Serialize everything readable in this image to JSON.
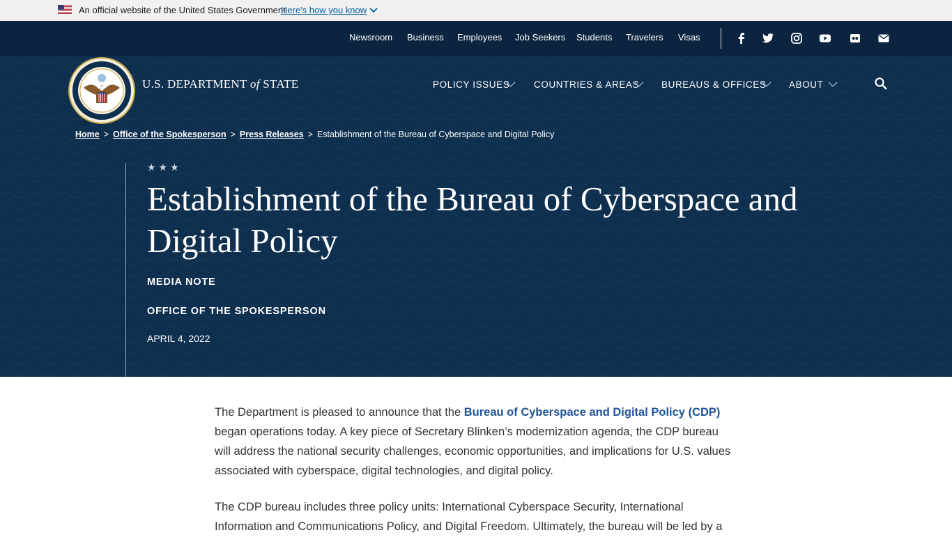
{
  "gov_banner": {
    "text": "An official website of the United States Government",
    "link": "Here's how you know"
  },
  "utility_nav": {
    "items": [
      "Newsroom",
      "Business",
      "Employees",
      "Job Seekers",
      "Students",
      "Travelers",
      "Visas"
    ]
  },
  "social": [
    "facebook-icon",
    "twitter-icon",
    "instagram-icon",
    "youtube-icon",
    "flickr-icon",
    "email-icon"
  ],
  "site": {
    "title_pre": "U.S. DEPARTMENT ",
    "title_of": "of",
    "title_post": " STATE"
  },
  "main_nav": {
    "items": [
      "POLICY ISSUES",
      "COUNTRIES & AREAS",
      "BUREAUS & OFFICES",
      "ABOUT"
    ]
  },
  "breadcrumb": {
    "home": "Home",
    "office": "Office of the Spokesperson",
    "press": "Press Releases",
    "current": "Establishment of the Bureau of Cyberspace and Digital Policy",
    "separator": ">"
  },
  "hero": {
    "stars": "★★★",
    "title": "Establishment of the Bureau of Cyberspace and Digital Policy",
    "type": "MEDIA NOTE",
    "office": "OFFICE OF THE SPOKESPERSON",
    "date": "APRIL 4, 2022"
  },
  "article": {
    "p1_pre": "The Department is pleased to announce that the ",
    "p1_link": "Bureau of Cyberspace and Digital Policy (CDP)",
    "p1_post": " began operations today. A key piece of Secretary Blinken’s modernization agenda, the CDP bureau will address the national security challenges, economic opportunities, and implications for U.S. values associated with cyberspace, digital technologies, and digital policy.",
    "p2": "The CDP bureau includes three policy units: International Cyberspace Security, International Information and Communications Policy, and Digital Freedom. Ultimately, the bureau will be led by a"
  },
  "colors": {
    "header_bg": "#0e2f4e",
    "utility_bg": "#0b2540",
    "link_blue": "#205493",
    "gov_link": "#005ea2"
  }
}
